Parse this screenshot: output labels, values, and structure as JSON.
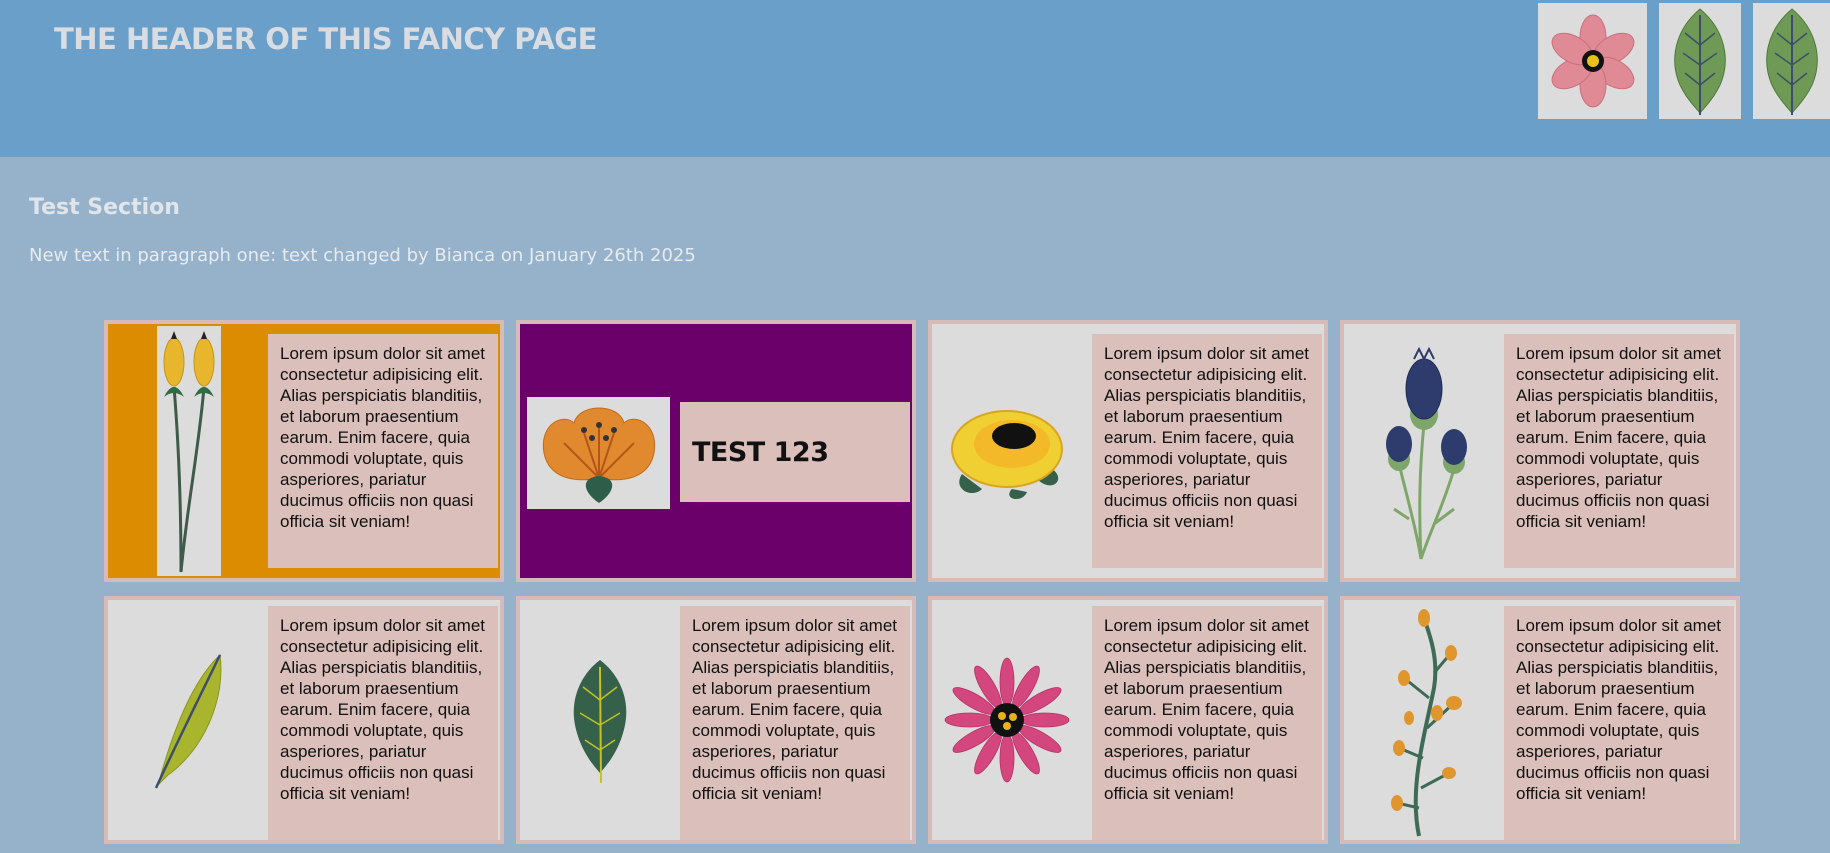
{
  "header": {
    "title": "THE HEADER OF THIS FANCY PAGE",
    "images": [
      "pink-flower-icon",
      "green-leaf-icon",
      "green-leaf-icon"
    ]
  },
  "section": {
    "title": "Test Section",
    "paragraph": "New text in paragraph one: text changed by Bianca on January 26th 2025"
  },
  "cards": [
    {
      "image": "yellow-buds-icon",
      "text": "Lorem ipsum dolor sit amet consectetur adipisicing elit. Alias perspiciatis blanditiis, et laborum praesentium earum. Enim facere, quia commodi voluptate, quis asperiores, pariatur ducimus officiis non quasi officia sit veniam!",
      "bg": "#dc8c00"
    },
    {
      "image": "orange-flower-icon",
      "text": "TEST 123",
      "bg": "#6b006b"
    },
    {
      "image": "yellow-rose-icon",
      "text": "Lorem ipsum dolor sit amet consectetur adipisicing elit. Alias perspiciatis blanditiis, et laborum praesentium earum. Enim facere, quia commodi voluptate, quis asperiores, pariatur ducimus officiis non quasi officia sit veniam!",
      "bg": "#dcdcdc"
    },
    {
      "image": "blue-thistle-icon",
      "text": "Lorem ipsum dolor sit amet consectetur adipisicing elit. Alias perspiciatis blanditiis, et laborum praesentium earum. Enim facere, quia commodi voluptate, quis asperiores, pariatur ducimus officiis non quasi officia sit veniam!",
      "bg": "#dcdcdc"
    },
    {
      "image": "olive-leaf-icon",
      "text": "Lorem ipsum dolor sit amet consectetur adipisicing elit. Alias perspiciatis blanditiis, et laborum praesentium earum. Enim facere, quia commodi voluptate, quis asperiores, pariatur ducimus officiis non quasi officia sit veniam!",
      "bg": "#dcdcdc"
    },
    {
      "image": "dark-leaf-icon",
      "text": "Lorem ipsum dolor sit amet consectetur adipisicing elit. Alias perspiciatis blanditiis, et laborum praesentium earum. Enim facere, quia commodi voluptate, quis asperiores, pariatur ducimus officiis non quasi officia sit veniam!",
      "bg": "#dcdcdc"
    },
    {
      "image": "pink-daisy-icon",
      "text": "Lorem ipsum dolor sit amet consectetur adipisicing elit. Alias perspiciatis blanditiis, et laborum praesentium earum. Enim facere, quia commodi voluptate, quis asperiores, pariatur ducimus officiis non quasi officia sit veniam!",
      "bg": "#dcdcdc"
    },
    {
      "image": "orange-berry-branch-icon",
      "text": "Lorem ipsum dolor sit amet consectetur adipisicing elit. Alias perspiciatis blanditiis, et laborum praesentium earum. Enim facere, quia commodi voluptate, quis asperiores, pariatur ducimus officiis non quasi officia sit veniam!",
      "bg": "#dcdcdc"
    }
  ],
  "colors": {
    "header_bg": "#6a9fca",
    "page_bg": "#96b2cb",
    "card_border": "#d6bbb9",
    "text_box_bg": "#dabfba",
    "orange_card": "#dc8c00",
    "purple_card": "#6b006b"
  }
}
